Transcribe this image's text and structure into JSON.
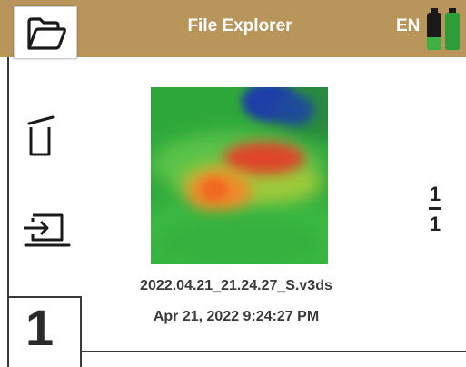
{
  "header": {
    "title": "File Explorer",
    "language": "EN",
    "background_color": "#b8955a",
    "batteries": [
      {
        "level": 0.35,
        "color": "#3cb043"
      },
      {
        "level": 1.0,
        "color": "#2e9e3a"
      }
    ]
  },
  "sidebar": {
    "items": [
      {
        "icon": "folder-open-icon",
        "selected": true
      },
      {
        "icon": "trash-icon",
        "selected": false
      },
      {
        "icon": "export-icon",
        "selected": false
      }
    ]
  },
  "file": {
    "name": "2022.04.21_21.24.27_S.v3ds",
    "date": "Apr 21, 2022 9:24:27 PM"
  },
  "pager": {
    "current": "1",
    "total": "1"
  },
  "channel": {
    "number": "1"
  }
}
